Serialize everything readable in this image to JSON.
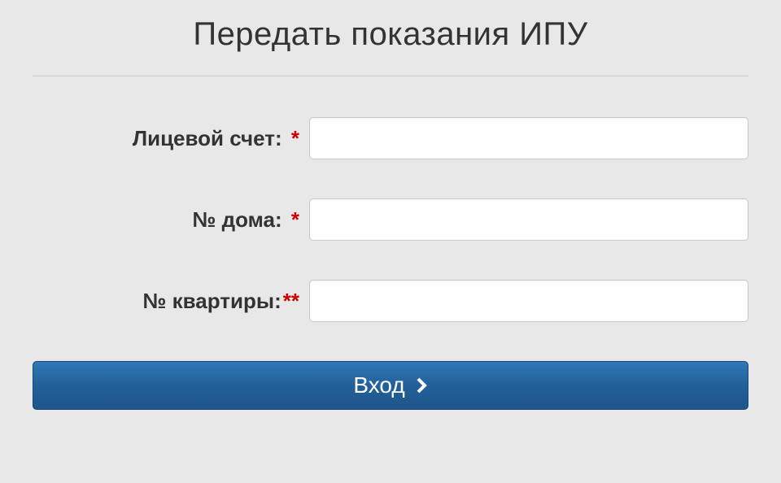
{
  "form": {
    "title": "Передать показания ИПУ",
    "fields": {
      "account": {
        "label": "Лицевой счет:",
        "required_mark": "*",
        "value": ""
      },
      "house": {
        "label": "№ дома:",
        "required_mark": "*",
        "value": ""
      },
      "apartment": {
        "label": "№ квартиры:",
        "required_mark": "**",
        "value": ""
      }
    },
    "submit_label": "Вход"
  },
  "colors": {
    "required": "#cc0000",
    "button_bg": "#236099",
    "text": "#333333"
  }
}
